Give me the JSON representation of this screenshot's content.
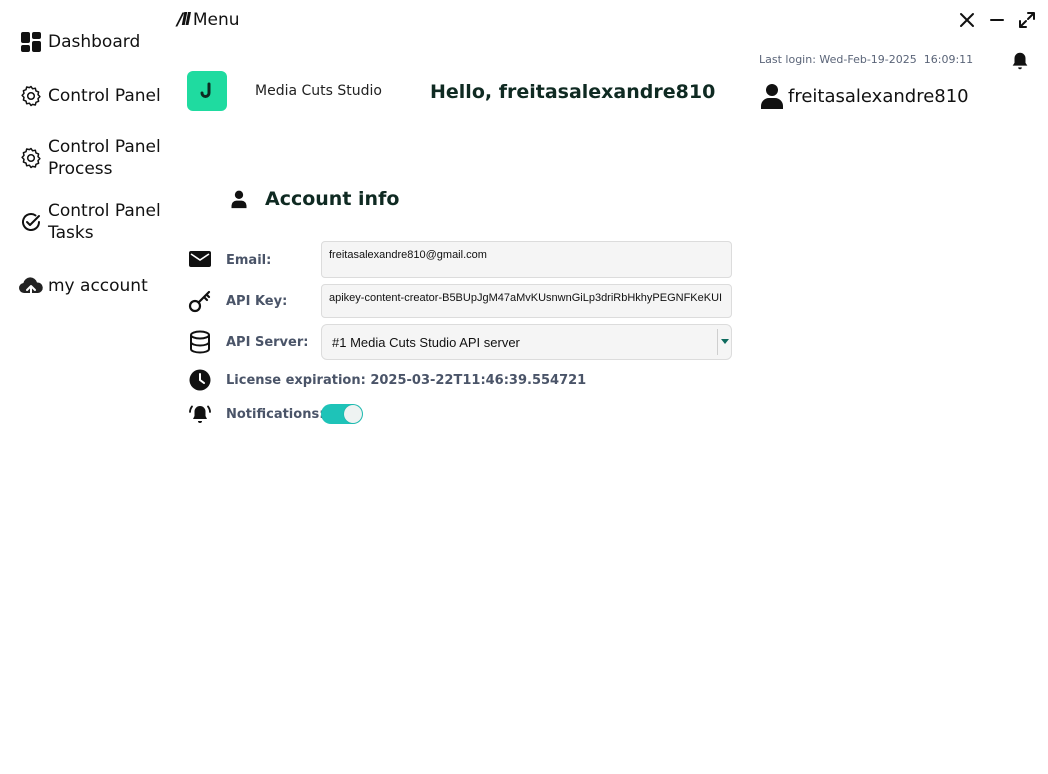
{
  "sidebar": {
    "items": [
      {
        "label": "Dashboard",
        "icon": "dashboard-icon"
      },
      {
        "label": "Control Panel",
        "icon": "gear-icon"
      },
      {
        "label": "Control Panel\nProcess",
        "icon": "gear-icon"
      },
      {
        "label": "Control Panel\nTasks",
        "icon": "check-circle-icon"
      },
      {
        "label": "my account",
        "icon": "cloud-upload-icon"
      }
    ]
  },
  "topbar": {
    "menu_label": "Menu",
    "menu_icon": "menu-slashes-icon",
    "last_login": "Last login: Wed-Feb-19-2025  16:09:11"
  },
  "header": {
    "studio_name": "Media Cuts Studio",
    "greeting": "Hello, freitasalexandre810",
    "username": "freitasalexandre810"
  },
  "account": {
    "title": "Account info",
    "email_label": "Email:",
    "email_value": "freitasalexandre810@gmail.com",
    "apikey_label": "API Key:",
    "apikey_value": "apikey-content-creator-B5BUpJgM47aMvKUsnwnGiLp3driRbHkhyPEGNFKeKUI",
    "server_label": "API Server:",
    "server_value": "#1 Media Cuts Studio API server",
    "license_text": "License expiration: 2025-03-22T11:46:39.554721",
    "notifications_label": "Notifications:",
    "notifications_on": true
  },
  "colors": {
    "accent": "#1fdba0",
    "toggle": "#1ec3b8",
    "heading": "#0f2a22",
    "label": "#4a5468"
  }
}
